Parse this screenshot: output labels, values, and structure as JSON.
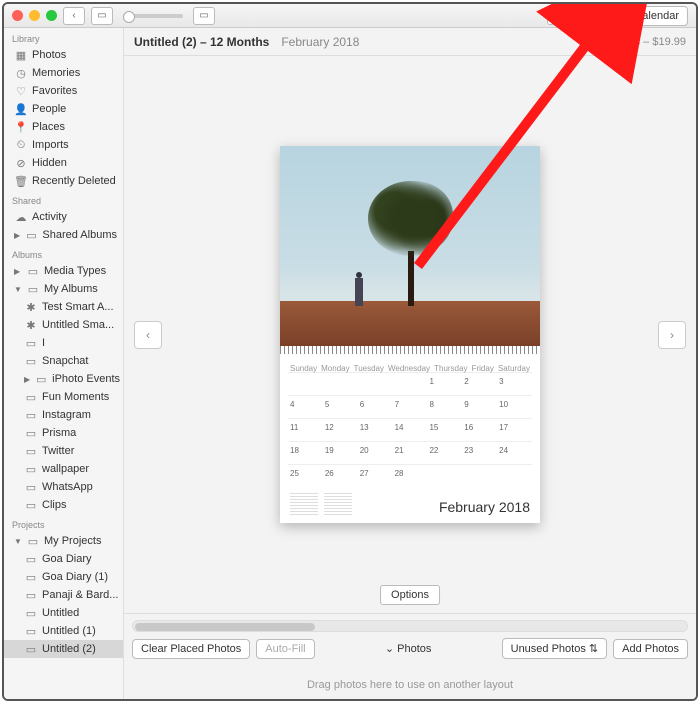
{
  "titlebar": {
    "buy_label": "Buy Calendar"
  },
  "header": {
    "title": "Untitled (2) – 12 Months",
    "subtitle": "February 2018",
    "price": "12 Months – $19.99"
  },
  "sidebar": {
    "sections": {
      "library": "Library",
      "shared": "Shared",
      "albums": "Albums",
      "projects": "Projects"
    },
    "library": [
      "Photos",
      "Memories",
      "Favorites",
      "People",
      "Places",
      "Imports",
      "Hidden",
      "Recently Deleted"
    ],
    "shared": [
      "Activity",
      "Shared Albums"
    ],
    "albums_top": [
      "Media Types",
      "My Albums"
    ],
    "my_albums": [
      "Test Smart A...",
      "Untitled Sma...",
      "I",
      "Snapchat",
      "iPhoto Events",
      "Fun Moments",
      "Instagram",
      "Prisma",
      "Twitter",
      "wallpaper",
      "WhatsApp",
      "Clips"
    ],
    "projects_top": "My Projects",
    "projects": [
      "Goa Diary",
      "Goa Diary (1)",
      "Panaji & Bard...",
      "Untitled",
      "Untitled (1)",
      "Untitled (2)"
    ]
  },
  "calendar": {
    "month_label": "February 2018",
    "day_headers": [
      "Sunday",
      "Monday",
      "Tuesday",
      "Wednesday",
      "Thursday",
      "Friday",
      "Saturday"
    ],
    "weeks": [
      [
        "",
        "",
        "",
        "",
        "1",
        "2",
        "3"
      ],
      [
        "4",
        "5",
        "6",
        "7",
        "8",
        "9",
        "10"
      ],
      [
        "11",
        "12",
        "13",
        "14",
        "15",
        "16",
        "17"
      ],
      [
        "18",
        "19",
        "20",
        "21",
        "22",
        "23",
        "24"
      ],
      [
        "25",
        "26",
        "27",
        "28",
        "",
        "",
        ""
      ]
    ],
    "options_label": "Options"
  },
  "footer": {
    "clear": "Clear Placed Photos",
    "autofill": "Auto-Fill",
    "photos_toggle": "Photos",
    "unused": "Unused Photos",
    "add": "Add Photos",
    "drag_hint": "Drag photos here to use on another layout"
  }
}
